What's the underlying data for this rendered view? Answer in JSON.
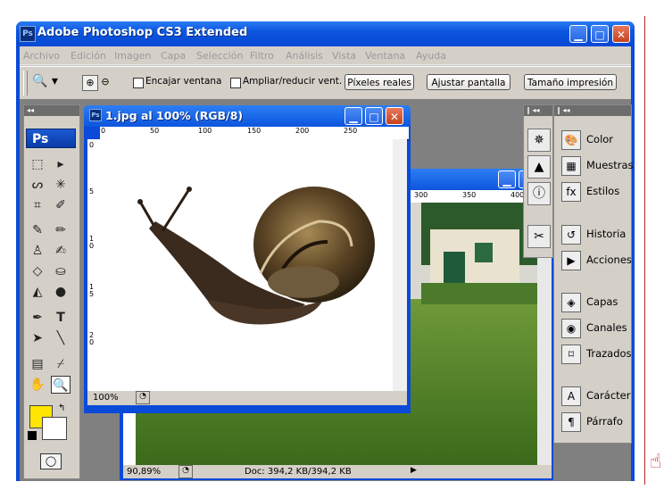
{
  "app": {
    "title": "Adobe Photoshop CS3 Extended",
    "icon": "Ps"
  },
  "menu": [
    "Archivo",
    "Edición",
    "Imagen",
    "Capa",
    "Selección",
    "Filtro",
    "Análisis",
    "Vista",
    "Ventana",
    "Ayuda"
  ],
  "options": {
    "fit_window": "Encajar ventana",
    "resize_window": "Ampliar/reducir vent.",
    "actual_pixels": "Píxeles reales",
    "fit_screen": "Ajustar pantalla",
    "print_size": "Tamaño impresión"
  },
  "toolbox": {
    "logo": "Ps",
    "collapse": "◂◂"
  },
  "doc1": {
    "title": "1.jpg al 100% (RGB/8)",
    "zoom": "100%",
    "ruler_h": [
      "0",
      "50",
      "100",
      "150",
      "200",
      "250"
    ],
    "ruler_v": [
      "0",
      "5",
      "1\n0",
      "1\n5",
      "2\n0"
    ]
  },
  "doc2": {
    "zoom": "90,89%",
    "doc_info": "Doc: 394,2 KB/394,2 KB",
    "ruler_h": [
      "300",
      "350",
      "400"
    ]
  },
  "panels": {
    "color": "Color",
    "swatches": "Muestras",
    "styles": "Estilos",
    "history": "Historia",
    "actions": "Acciones",
    "layers": "Capas",
    "channels": "Canales",
    "paths": "Trazados",
    "character": "Carácter",
    "paragraph": "Párrafo"
  },
  "colors": {
    "foreground": "#ffe500",
    "background": "#ffffff",
    "titlebar": "#0c56e0",
    "frame_line": "#b8272e"
  }
}
